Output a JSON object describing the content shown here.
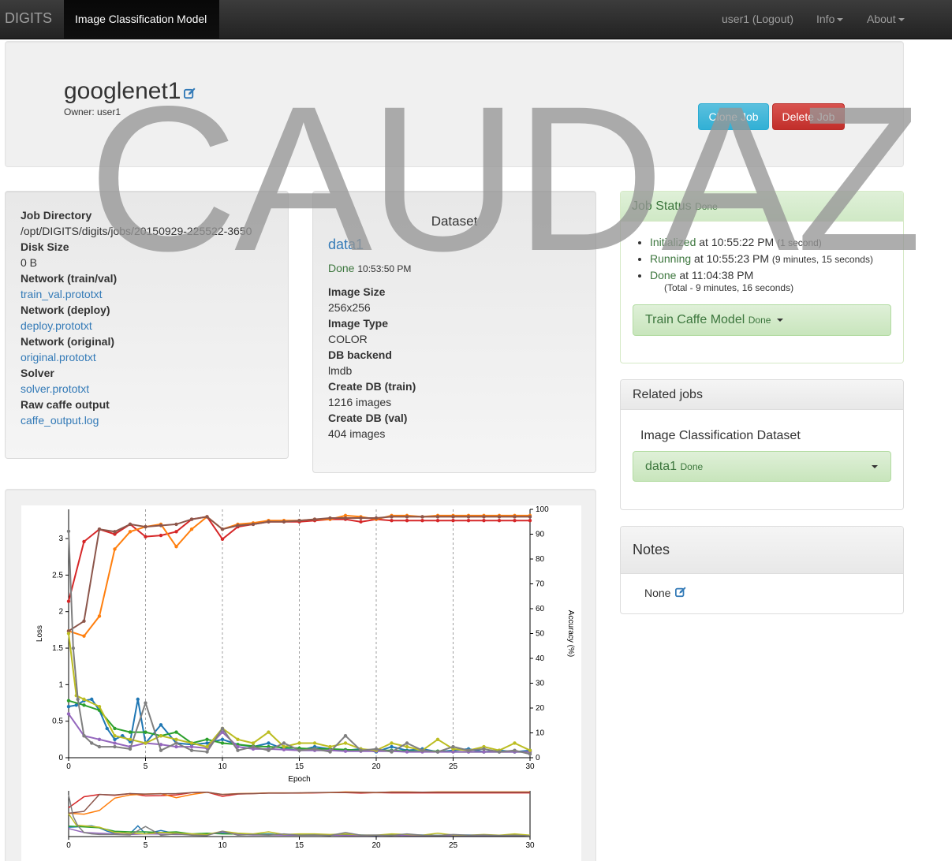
{
  "navbar": {
    "brand": "DIGITS",
    "active_tab": "Image Classification Model",
    "user": "user1 (Logout)",
    "info": "Info",
    "about": "About"
  },
  "header": {
    "title": "googlenet1",
    "owner": "Owner: user1",
    "clone_label": "Clone Job",
    "delete_label": "Delete Job"
  },
  "job_info": {
    "job_directory_label": "Job Directory",
    "job_directory_value": "/opt/DIGITS/digits/jobs/20150929-225522-3650",
    "disk_size_label": "Disk Size",
    "disk_size_value": "0 B",
    "network_trainval_label": "Network (train/val)",
    "network_trainval_value": "train_val.prototxt",
    "network_deploy_label": "Network (deploy)",
    "network_deploy_value": "deploy.prototxt",
    "network_original_label": "Network (original)",
    "network_original_value": "original.prototxt",
    "solver_label": "Solver",
    "solver_value": "solver.prototxt",
    "raw_output_label": "Raw caffe output",
    "raw_output_value": "caffe_output.log"
  },
  "dataset": {
    "heading": "Dataset",
    "name": "data1",
    "status": "Done",
    "status_time": "10:53:50 PM",
    "image_size_label": "Image Size",
    "image_size_value": "256x256",
    "image_type_label": "Image Type",
    "image_type_value": "COLOR",
    "db_backend_label": "DB backend",
    "db_backend_value": "lmdb",
    "create_train_label": "Create DB (train)",
    "create_train_value": "1216 images",
    "create_val_label": "Create DB (val)",
    "create_val_value": "404 images"
  },
  "job_status": {
    "heading": "Job Status",
    "heading_status": "Done",
    "items": [
      {
        "state": "Initialized",
        "at": " at 10:55:22 PM ",
        "dur": "(1 second)"
      },
      {
        "state": "Running",
        "at": " at 10:55:23 PM ",
        "dur": "(9 minutes, 15 seconds)"
      },
      {
        "state": "Done",
        "at": " at 11:04:38 PM",
        "dur": ""
      }
    ],
    "total": "(Total - 9 minutes, 16 seconds)",
    "train_label": "Train Caffe Model",
    "train_status": "Done"
  },
  "related": {
    "heading": "Related jobs",
    "subheading": "Image Classification Dataset",
    "job_name": "data1",
    "job_status": "Done"
  },
  "notes": {
    "heading": "Notes",
    "value": "None"
  },
  "watermark": "CAUDAZ",
  "colors": {
    "accent": "#337ab7",
    "success": "#3c763d",
    "loss_train_blue": "#1f77b4",
    "loss_val_green": "#2ca02c",
    "loss_val_purple": "#9467bd",
    "loss_val_olive": "#bcbd22",
    "loss_val_grey": "#7f7f7f",
    "acc_red": "#d62728",
    "acc_orange": "#ff7f0e",
    "acc_brown": "#8c564b"
  },
  "chart_data": {
    "type": "line",
    "xlabel": "Epoch",
    "ylabel": "Loss",
    "y2label": "Accuracy (%)",
    "xlim": [
      0,
      30
    ],
    "ylim": [
      0,
      3.4
    ],
    "y2lim": [
      0,
      100
    ],
    "xticks": [
      0,
      5,
      10,
      15,
      20,
      25,
      30
    ],
    "yticks": [
      0,
      0.5,
      1,
      1.5,
      2,
      2.5,
      3
    ],
    "y2ticks": [
      0,
      10,
      20,
      30,
      40,
      50,
      60,
      70,
      80,
      90,
      100
    ],
    "grid_x": "dashed vertical lines at every 5 epochs",
    "series": [
      {
        "axis": "accuracy",
        "color": "#d62728",
        "x": [
          0,
          1,
          2,
          3,
          4,
          5,
          6,
          7,
          8,
          9,
          10,
          11,
          12,
          13,
          14,
          15,
          16,
          17,
          18,
          19,
          20,
          21,
          22,
          23,
          24,
          25,
          26,
          27,
          28,
          29,
          30
        ],
        "y": [
          63,
          87,
          92,
          90,
          94,
          89,
          89.5,
          91,
          96,
          97,
          88,
          93,
          94,
          95,
          95,
          95,
          95.5,
          96,
          96,
          95,
          96,
          95.5,
          95.5,
          95.5,
          95.5,
          95.5,
          95.5,
          95.5,
          95.5,
          95.5,
          95.5
        ]
      },
      {
        "axis": "accuracy",
        "color": "#ff7f0e",
        "x": [
          0,
          1,
          2,
          3,
          4,
          5,
          6,
          7,
          8,
          9,
          10,
          11,
          12,
          13,
          14,
          15,
          16,
          17,
          18,
          19,
          20,
          21,
          22,
          23,
          24,
          25,
          26,
          27,
          28,
          29,
          30
        ],
        "y": [
          51,
          49,
          57,
          84,
          91,
          93,
          94,
          85,
          92,
          97,
          92,
          94,
          94.5,
          95.5,
          95.5,
          95.5,
          96,
          96,
          97.5,
          97,
          96,
          97.5,
          97.5,
          97,
          97.5,
          97.5,
          97.5,
          97.5,
          97.5,
          97.5,
          97.5
        ]
      },
      {
        "axis": "accuracy",
        "color": "#8c564b",
        "x": [
          0,
          1,
          2,
          3,
          4,
          5,
          6,
          7,
          8,
          9,
          10,
          11,
          12,
          13,
          14,
          15,
          16,
          17,
          18,
          19,
          20,
          21,
          22,
          23,
          24,
          25,
          26,
          27,
          28,
          29,
          30
        ],
        "y": [
          51,
          55,
          92,
          91,
          94,
          93,
          93.5,
          94,
          96,
          97,
          92,
          93.5,
          94,
          95,
          95,
          95.5,
          96,
          96.5,
          96.5,
          96.5,
          96.5,
          97,
          97,
          97,
          97,
          97,
          97,
          97,
          97,
          97,
          97
        ]
      },
      {
        "axis": "loss",
        "color": "#1f77b4",
        "x": [
          0,
          0.5,
          1,
          1.5,
          2,
          2.5,
          3,
          3.5,
          4,
          4.5,
          5,
          6,
          7,
          8,
          9,
          10,
          11,
          12,
          13,
          14,
          15,
          16,
          17,
          18,
          19,
          20,
          21,
          22,
          23,
          24,
          25,
          26,
          27,
          28,
          29,
          30
        ],
        "y": [
          0.7,
          0.72,
          0.78,
          0.8,
          0.65,
          0.4,
          0.25,
          0.3,
          0.22,
          0.8,
          0.2,
          0.45,
          0.2,
          0.18,
          0.2,
          0.25,
          0.18,
          0.15,
          0.2,
          0.12,
          0.1,
          0.15,
          0.12,
          0.1,
          0.12,
          0.08,
          0.15,
          0.1,
          0.12,
          0.08,
          0.1,
          0.12,
          0.08,
          0.1,
          0.08,
          0.1
        ]
      },
      {
        "axis": "loss",
        "color": "#2ca02c",
        "x": [
          0,
          1,
          2,
          3,
          4,
          5,
          6,
          7,
          8,
          9,
          10,
          11,
          12,
          13,
          14,
          15,
          16,
          17,
          18,
          19,
          20,
          21,
          22,
          23,
          24,
          25,
          26,
          27,
          28,
          29,
          30
        ],
        "y": [
          0.78,
          0.72,
          0.65,
          0.4,
          0.35,
          0.35,
          0.3,
          0.35,
          0.2,
          0.25,
          0.2,
          0.18,
          0.16,
          0.15,
          0.14,
          0.13,
          0.12,
          0.12,
          0.11,
          0.1,
          0.1,
          0.1,
          0.09,
          0.09,
          0.09,
          0.08,
          0.08,
          0.08,
          0.08,
          0.08,
          0.08
        ]
      },
      {
        "axis": "loss",
        "color": "#9467bd",
        "x": [
          0,
          1,
          2,
          3,
          4,
          5,
          6,
          7,
          8,
          9,
          10,
          11,
          12,
          13,
          14,
          15,
          16,
          17,
          18,
          19,
          20,
          21,
          22,
          23,
          24,
          25,
          26,
          27,
          28,
          29,
          30
        ],
        "y": [
          0.6,
          0.3,
          0.25,
          0.2,
          0.15,
          0.2,
          0.18,
          0.15,
          0.15,
          0.13,
          0.35,
          0.15,
          0.12,
          0.12,
          0.11,
          0.1,
          0.1,
          0.1,
          0.09,
          0.09,
          0.09,
          0.09,
          0.08,
          0.08,
          0.08,
          0.08,
          0.08,
          0.08,
          0.08,
          0.08,
          0.08
        ]
      },
      {
        "axis": "loss",
        "color": "#bcbd22",
        "x": [
          0,
          0.5,
          1,
          2,
          3,
          4,
          5,
          6,
          7,
          8,
          9,
          10,
          11,
          12,
          13,
          14,
          15,
          16,
          17,
          18,
          19,
          20,
          21,
          22,
          23,
          24,
          25,
          26,
          27,
          28,
          29,
          30
        ],
        "y": [
          1.7,
          0.85,
          0.8,
          0.7,
          0.3,
          0.25,
          0.2,
          0.3,
          0.25,
          0.2,
          0.15,
          0.4,
          0.25,
          0.2,
          0.35,
          0.15,
          0.2,
          0.2,
          0.15,
          0.2,
          0.12,
          0.1,
          0.2,
          0.15,
          0.1,
          0.25,
          0.12,
          0.1,
          0.15,
          0.1,
          0.2,
          0.1
        ]
      },
      {
        "axis": "loss",
        "color": "#7f7f7f",
        "x": [
          0,
          0.3,
          0.6,
          1,
          1.5,
          2,
          3,
          4,
          5,
          6,
          7,
          8,
          9,
          10,
          11,
          12,
          13,
          14,
          15,
          16,
          17,
          18,
          19,
          20,
          21,
          22,
          23,
          24,
          25,
          26,
          27,
          28,
          29,
          30
        ],
        "y": [
          3.1,
          1.5,
          0.8,
          0.3,
          0.2,
          0.15,
          0.15,
          0.12,
          0.75,
          0.1,
          0.2,
          0.1,
          0.08,
          0.4,
          0.1,
          0.15,
          0.1,
          0.2,
          0.1,
          0.12,
          0.08,
          0.3,
          0.1,
          0.12,
          0.08,
          0.2,
          0.1,
          0.08,
          0.15,
          0.1,
          0.12,
          0.08,
          0.1,
          0.05
        ]
      }
    ],
    "overview": {
      "xticks": [
        0,
        5,
        10,
        15,
        20,
        25,
        30
      ]
    }
  }
}
